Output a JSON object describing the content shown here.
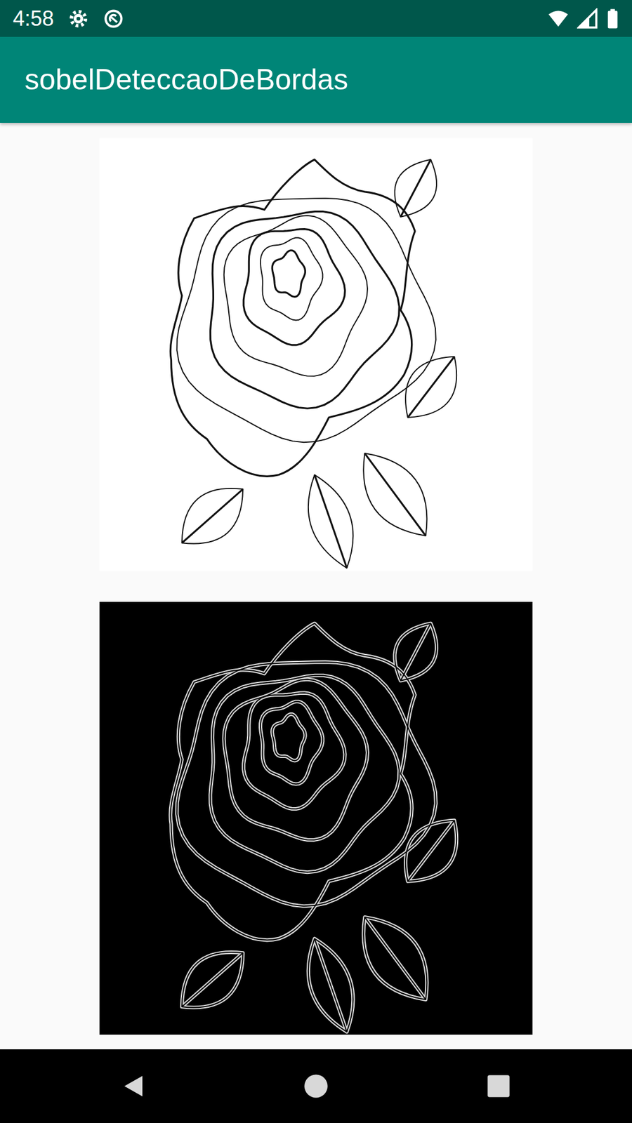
{
  "status_bar": {
    "time": "4:58"
  },
  "app_bar": {
    "title": "sobelDeteccaoDeBordas"
  },
  "images": [
    {
      "kind": "original"
    },
    {
      "kind": "edges"
    }
  ]
}
